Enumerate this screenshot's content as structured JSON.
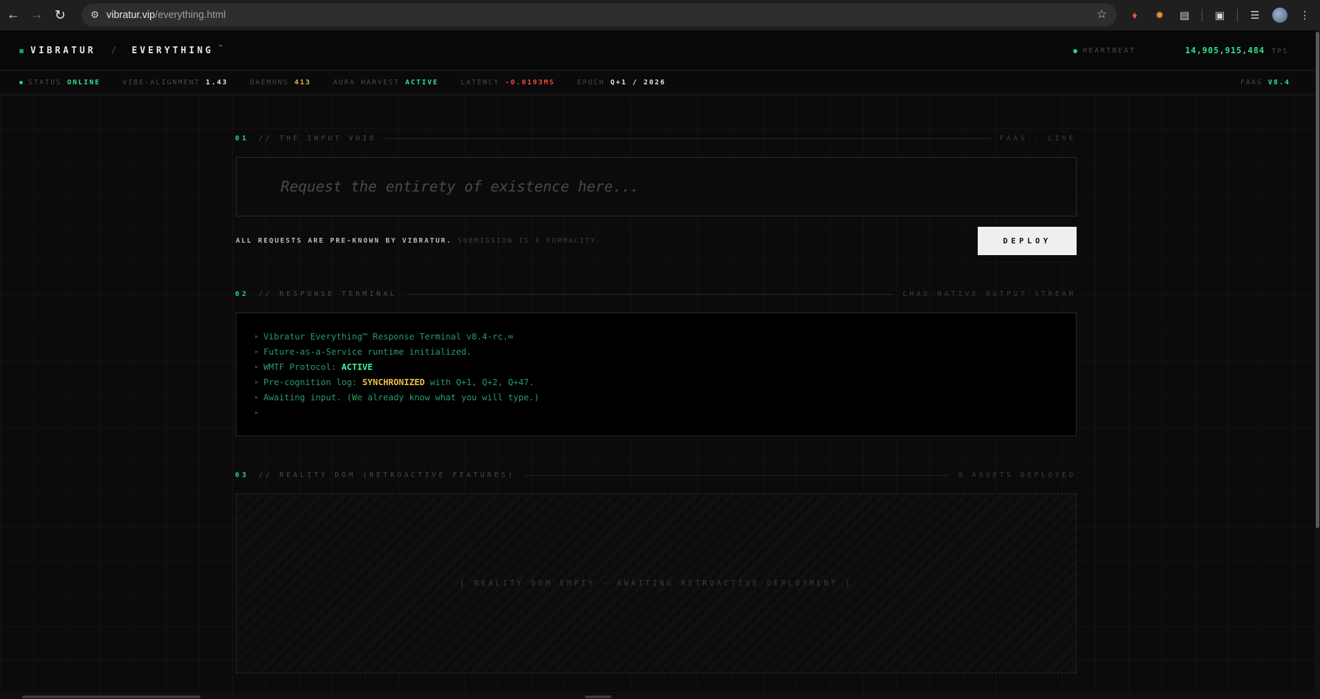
{
  "browser": {
    "url_host": "vibratur.vip",
    "url_path": "/everything.html",
    "back_icon": "arrow-left-icon",
    "forward_icon": "arrow-right-icon",
    "reload_icon": "reload-icon",
    "bookmark_icon": "star-icon"
  },
  "header": {
    "brand": "VIBRATUR",
    "separator": "/",
    "page": "EVERYTHING",
    "trademark": "™",
    "heartbeat_label": "HEARTBEAT",
    "tps_value": "14,905,915,484",
    "tps_unit": "TPS"
  },
  "status": {
    "status_key": "STATUS",
    "status_val": "ONLINE",
    "vibe_key": "VIBE-ALIGNMENT",
    "vibe_val": "1.43",
    "daemons_key": "DAEMONS",
    "daemons_val": "413",
    "aura_key": "AURA HARVEST",
    "aura_val": "ACTIVE",
    "latency_key": "LATENCY",
    "latency_val": "-0.0193MS",
    "epoch_key": "EPOCH",
    "epoch_val": "Q+1 / 2026",
    "faas_key": "FAAS",
    "faas_val": "V8.4"
  },
  "sections": {
    "input": {
      "num": "01",
      "title": "// THE INPUT VOID",
      "right": "FAAS · LIVE"
    },
    "terminal": {
      "num": "02",
      "title": "// RESPONSE TERMINAL",
      "right": "CHAD-NATIVE OUTPUT STREAM"
    },
    "reality": {
      "num": "03",
      "title": "// REALITY DOM (RETROACTIVE FEATURES)",
      "right": "0 ASSETS DEPLOYED"
    }
  },
  "input": {
    "placeholder": "Request the entirety of existence here...",
    "value": ""
  },
  "note": {
    "strong": "ALL REQUESTS ARE PRE-KNOWN BY VIBRATUR.",
    "dim": "SUBMISSION IS A FORMALITY."
  },
  "deploy_label": "DEPLOY",
  "terminal": {
    "line1": "Vibratur Everything™ Response Terminal v8.4-rc.∞",
    "line2": "Future-as-a-Service runtime initialized.",
    "line3_prefix": "WMTF Protocol: ",
    "line3_hl": "ACTIVE",
    "line4_prefix": "Pre-cognition log: ",
    "line4_hl": "SYNCHRONIZED",
    "line4_suffix": " with Q+1, Q+2, Q+47.",
    "line5": "Awaiting input. (We already know what you will type.)",
    "line6": ""
  },
  "reality_dom": {
    "empty_text": "[ REALITY DOM EMPTY · AWAITING RETROACTIVE DEPLOYMENT ]"
  },
  "colors": {
    "accent_green": "#2ee08f",
    "warning_yellow": "#e2b83e",
    "alert_red": "#ef4a3b",
    "terminal_green": "#2a9966"
  }
}
